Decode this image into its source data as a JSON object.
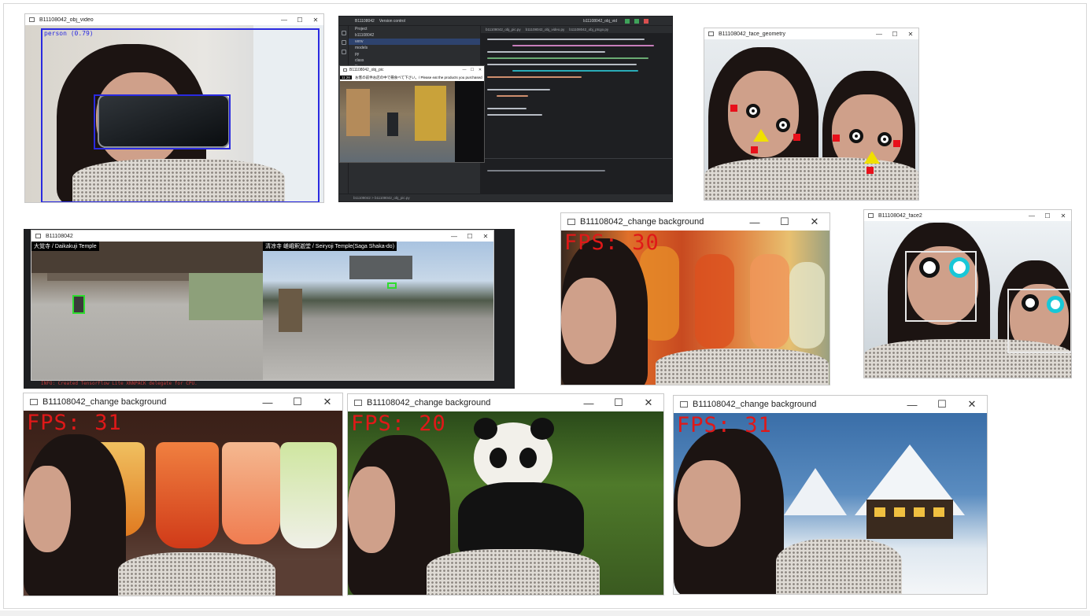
{
  "windows": {
    "obj_video": {
      "title": "B11108042_obj_video",
      "detection_label": "person (0.79)"
    },
    "ide": {
      "project_label": "Project",
      "menu_label": "B11108042",
      "branch_label": "Version control",
      "run_config": "b11108042_obj_vid",
      "tabs": [
        "b11108042_obj_pic.py",
        "b11108042_obj_video.py",
        "b11108042_obj_ptcgo.py"
      ],
      "tree_items": [
        "b11108042",
        "venv",
        "models",
        "py",
        "class",
        "libs"
      ],
      "status": "b11108042 > b11108042_obj_pic.py",
      "inner_window_title": "B11108042_obj_pic",
      "inner_time": "11:26",
      "inner_caption": "お客の前件お店の中で冊食べて下さい。/ Please eat the products you purchased"
    },
    "face_geometry": {
      "title": "B11108042_face_geometry"
    },
    "temples": {
      "title": "B11108042",
      "left_label": "大覚寺 / Daikakuji Temple",
      "right_label": "清凉寺 嵯峨釈迦堂 / Seiryoji Temple(Saga Shaka-do)",
      "log": "INFO: Created TensorFlow Lite XNNPACK delegate for CPU."
    },
    "change_bg_1": {
      "title": "B11108042_change background",
      "fps": "FPS: 30"
    },
    "face2": {
      "title": "B11108042_face2"
    },
    "change_bg_2": {
      "title": "B11108042_change background",
      "fps": "FPS: 31"
    },
    "change_bg_3": {
      "title": "B11108042_change background",
      "fps": "FPS: 20"
    },
    "change_bg_4": {
      "title": "B11108042_change background",
      "fps": "FPS: 31"
    }
  },
  "controls": {
    "minimize": "—",
    "maximize": "☐",
    "close": "✕"
  },
  "icons": [
    "window-app-icon",
    "minimize-icon",
    "maximize-icon",
    "close-icon"
  ]
}
